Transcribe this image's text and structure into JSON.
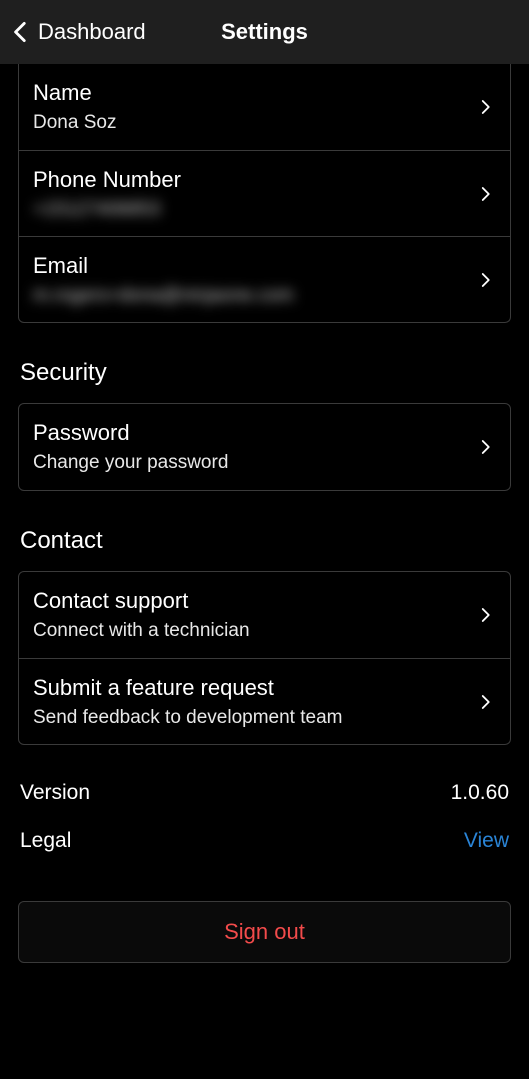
{
  "navbar": {
    "back_label": "Dashboard",
    "title": "Settings"
  },
  "account": {
    "rows": [
      {
        "title": "Name",
        "value": "Dona Soz",
        "masked": false
      },
      {
        "title": "Phone Number",
        "value": "+15127406853",
        "masked": true
      },
      {
        "title": "Email",
        "value": "m.rogers+dona@ninjaone.com",
        "masked": true
      }
    ]
  },
  "security": {
    "heading": "Security",
    "rows": [
      {
        "title": "Password",
        "sub": "Change your password"
      }
    ]
  },
  "contact": {
    "heading": "Contact",
    "rows": [
      {
        "title": "Contact support",
        "sub": "Connect with a technician"
      },
      {
        "title": "Submit a feature request",
        "sub": "Send feedback to development team"
      }
    ]
  },
  "info": {
    "version_label": "Version",
    "version_value": "1.0.60",
    "legal_label": "Legal",
    "legal_link": "View"
  },
  "signout_label": "Sign out"
}
